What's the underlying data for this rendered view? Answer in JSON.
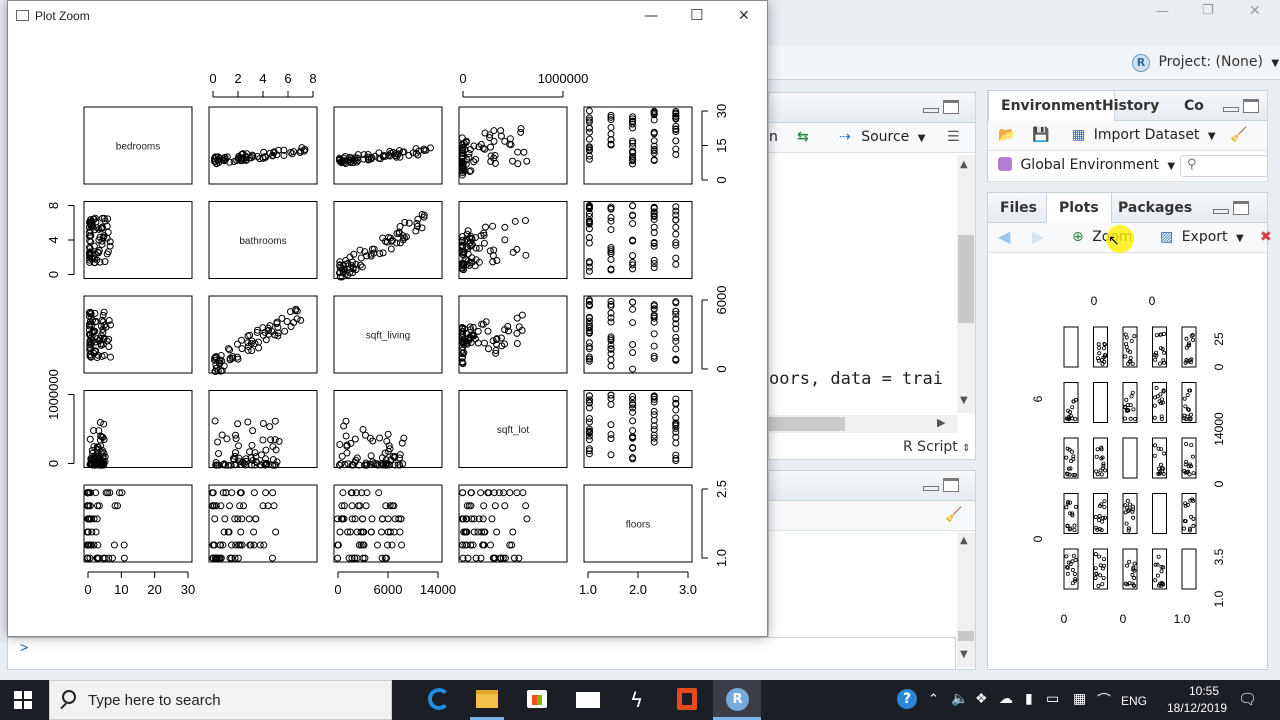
{
  "plot_window": {
    "title": "Plot Zoom",
    "controls": {
      "minimize": "—",
      "maximize": "☐",
      "close": "✕"
    }
  },
  "chart_data": {
    "type": "scatter-matrix",
    "variables": [
      "bedrooms",
      "bathrooms",
      "sqft_living",
      "sqft_lot",
      "floors"
    ],
    "top_axis_labels": [
      [
        "0",
        "2",
        "4",
        "6",
        "8"
      ],
      [],
      [
        [
          "0",
          "1000000"
        ]
      ],
      []
    ],
    "top_axes": {
      "bathrooms": [
        "0",
        "2",
        "4",
        "6",
        "8"
      ],
      "sqft_lot": [
        "0",
        "1000000"
      ]
    },
    "left_axes": {
      "bathrooms": [
        "0",
        "4",
        "8"
      ],
      "sqft_lot": [
        "0",
        "1000000"
      ]
    },
    "right_axes": {
      "bedrooms": [
        "0",
        "15",
        "30"
      ],
      "sqft_living": [
        "0",
        "6000"
      ],
      "floors": [
        "1.0",
        "2.5"
      ]
    },
    "bottom_axes": {
      "bedrooms": [
        "0",
        "10",
        "20",
        "30"
      ],
      "sqft_living": [
        "0",
        "6000",
        "14000"
      ],
      "floors": [
        "1.0",
        "2.0",
        "3.0"
      ]
    }
  },
  "rstudio": {
    "project": "Project: (None)",
    "source_pane": {
      "source_button": "Source",
      "script_type": "R Script",
      "code_snippet": "oors, data = trai"
    },
    "env_pane": {
      "tabs": [
        "Environment",
        "History",
        "Co"
      ],
      "import_dataset": "Import Dataset",
      "global_env": "Global Environment"
    },
    "files_pane": {
      "tabs": [
        "Files",
        "Plots",
        "Packages"
      ],
      "zoom": "Zoom",
      "export": "Export"
    },
    "console_prompt": ">",
    "mini_plot": {
      "top_labels": [
        "0",
        "0"
      ],
      "left_labels": [
        "6",
        "0"
      ],
      "right_labels": [
        "25",
        "0",
        "14000",
        "0",
        "3.5",
        "1.0"
      ],
      "bottom_labels": [
        "0",
        "0",
        "1.0"
      ]
    }
  },
  "taskbar": {
    "search_placeholder": "Type here to search",
    "language": "ENG",
    "time": "10:55",
    "date": "18/12/2019"
  },
  "colors": {
    "accent": "#2f7bbf",
    "taskbar": "#1c1e26"
  }
}
